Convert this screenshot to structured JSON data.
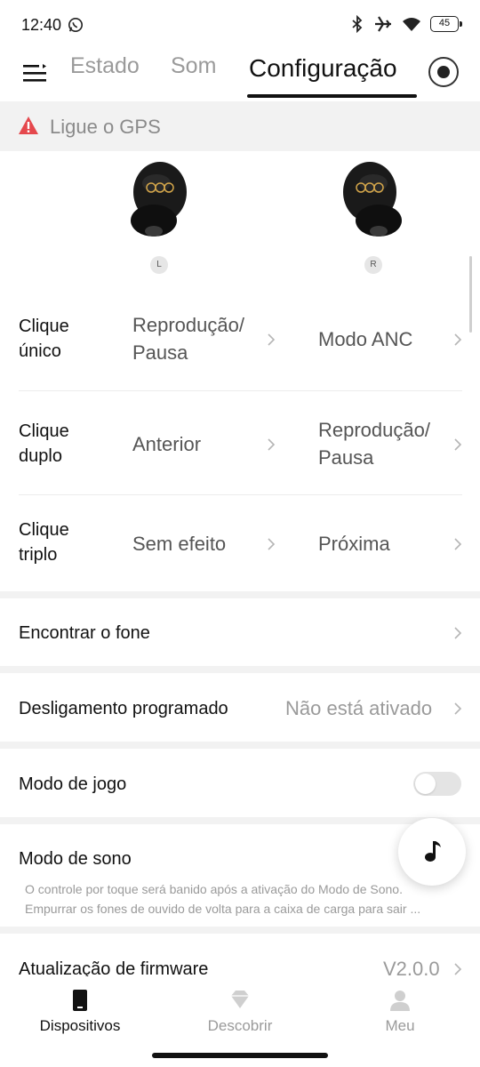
{
  "status_bar": {
    "time": "12:40",
    "battery": "45",
    "icons": [
      "whatsapp-icon",
      "bluetooth-icon",
      "airplane-icon",
      "wifi-icon",
      "battery-icon"
    ]
  },
  "header": {
    "tabs": [
      {
        "label": "Estado",
        "active": false
      },
      {
        "label": "Som",
        "active": false
      },
      {
        "label": "Configuração",
        "active": true
      }
    ]
  },
  "gps_banner": {
    "text": "Ligue o GPS",
    "color": "#e5484d"
  },
  "earbuds": {
    "left_label": "L",
    "right_label": "R"
  },
  "gestures": [
    {
      "name_line1": "Clique",
      "name_line2": "único",
      "left_line1": "Reprodução/",
      "left_line2": "Pausa",
      "right_line1": "Modo ANC",
      "right_line2": ""
    },
    {
      "name_line1": "Clique",
      "name_line2": "duplo",
      "left_line1": "Anterior",
      "left_line2": "",
      "right_line1": "Reprodução/",
      "right_line2": "Pausa"
    },
    {
      "name_line1": "Clique",
      "name_line2": "triplo",
      "left_line1": "Sem efeito",
      "left_line2": "",
      "right_line1": "Próxima",
      "right_line2": ""
    }
  ],
  "settings": {
    "find_earphone": {
      "label": "Encontrar o fone"
    },
    "scheduled_off": {
      "label": "Desligamento programado",
      "value": "Não está ativado"
    },
    "game_mode": {
      "label": "Modo de jogo",
      "enabled": false
    },
    "sleep_mode": {
      "label": "Modo de sono",
      "desc_line1": "O controle por toque será banido após a ativação do Modo de Sono.",
      "desc_line2": "Empurrar os fones de ouvido de volta para a caixa de carga para sair ..."
    },
    "firmware": {
      "label": "Atualização de firmware",
      "value": "V2.0.0"
    }
  },
  "bottom_nav": [
    {
      "label": "Dispositivos",
      "active": true,
      "icon": "phone-device-icon"
    },
    {
      "label": "Descobrir",
      "active": false,
      "icon": "diamond-icon"
    },
    {
      "label": "Meu",
      "active": false,
      "icon": "person-icon"
    }
  ],
  "colors": {
    "accent_text": "#111111",
    "inactive_text": "#9a9a9a"
  }
}
